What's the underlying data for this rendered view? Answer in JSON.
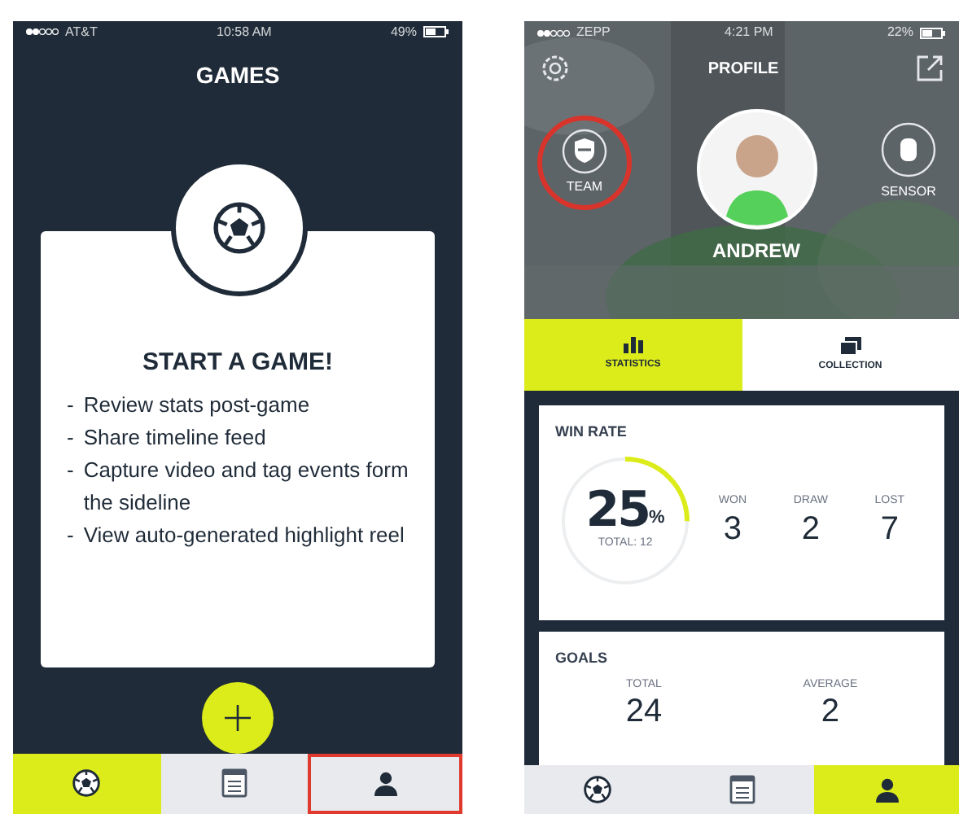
{
  "games_screen": {
    "status_bar": {
      "carrier": "AT&T",
      "time": "10:58 AM",
      "battery": "49%"
    },
    "title": "GAMES",
    "card": {
      "heading": "START A GAME!",
      "bullet": "-",
      "items": [
        "Review stats post-game",
        "Share timeline feed",
        "Capture video and tag events form the sideline",
        "View auto-generated highlight reel"
      ]
    },
    "tab_bar": [
      {
        "kind": "ball",
        "selected": true,
        "highlighted": false
      },
      {
        "kind": "calendar",
        "selected": false,
        "highlighted": false
      },
      {
        "kind": "person",
        "selected": false,
        "highlighted": true
      }
    ]
  },
  "profile_screen": {
    "status_bar": {
      "carrier": "ZEPP",
      "time": "4:21 PM",
      "battery": "22%"
    },
    "title": "PROFILE",
    "team": {
      "label": "TEAM",
      "highlighted": true
    },
    "name": "ANDREW",
    "sensor": {
      "label": "SENSOR"
    },
    "tabs": [
      {
        "kind": "chart",
        "label": "STATISTICS",
        "selected": true
      },
      {
        "kind": "collection",
        "label": "COLLECTION",
        "selected": false
      }
    ],
    "win_rate": {
      "title": "WIN RATE",
      "value": "25",
      "unit": "%",
      "level": 0.25,
      "total": "TOTAL: 12",
      "stats": [
        {
          "label": "WON",
          "value": "3"
        },
        {
          "label": "DRAW",
          "value": "2"
        },
        {
          "label": "LOST",
          "value": "7"
        }
      ]
    },
    "goals": {
      "title": "GOALS",
      "stats": [
        {
          "label": "TOTAL",
          "value": "24"
        },
        {
          "label": "AVERAGE",
          "value": "2"
        }
      ]
    },
    "tab_bar": [
      {
        "kind": "ball",
        "selected": false
      },
      {
        "kind": "calendar",
        "selected": false
      },
      {
        "kind": "person",
        "selected": true
      }
    ]
  }
}
